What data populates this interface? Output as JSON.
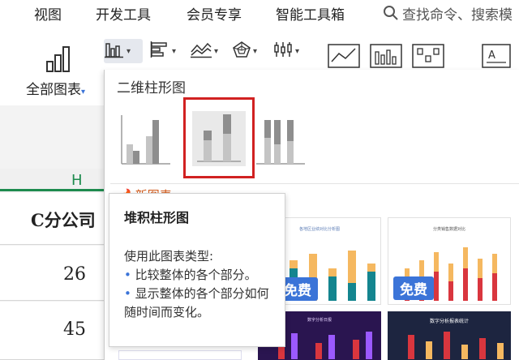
{
  "menubar": {
    "items": [
      "视图",
      "开发工具",
      "会员专享",
      "智能工具箱"
    ],
    "search_hint": "查找命令、搜索模"
  },
  "ribbon": {
    "all_charts_label": "全部图表",
    "chart_type_icons": [
      "column-chart-icon",
      "bar-chart-icon",
      "line-chart-icon",
      "radar-chart-icon",
      "stock-chart-icon"
    ]
  },
  "spreadsheet": {
    "column_label": "H",
    "header_cell_text": "C分公司",
    "values": [
      "26",
      "45"
    ]
  },
  "panel": {
    "section_title": "二维柱形图",
    "new_charts_label": "新图表",
    "free_label": "免费",
    "card_titles": [
      "各地区业绩对比分析图",
      "分类销售数据对比",
      "数字分析日报",
      "数字分析报表统计"
    ]
  },
  "tooltip": {
    "title": "堆积柱形图",
    "description": "使用此图表类型:",
    "items": [
      "比较整体的各个部分。",
      "显示整体的各个部分如何随时间而变化。"
    ]
  },
  "colors": {
    "accent_green": "#1e8b4e",
    "highlight_red": "#d12121",
    "badge_blue": "#3b74d8",
    "teal": "#14858f",
    "orange": "#f5b860",
    "red": "#d9363e"
  }
}
